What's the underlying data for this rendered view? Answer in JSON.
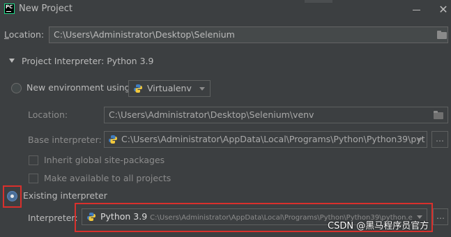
{
  "window": {
    "title": "New Project"
  },
  "location": {
    "label": "Location:",
    "value": "C:\\Users\\Administrator\\Desktop\\Selenium"
  },
  "interpreter_section": {
    "header": "Project Interpreter: Python 3.9"
  },
  "new_env": {
    "radio_label": "New environment using",
    "tool": "Virtualenv",
    "location_label": "Location:",
    "location_value": "C:\\Users\\Administrator\\Desktop\\Selenium\\venv",
    "base_label": "Base interpreter:",
    "base_value": "C:\\Users\\Administrator\\AppData\\Local\\Programs\\Python\\Python39\\pyt",
    "browse_label": "...",
    "inherit_label": "Inherit global site-packages",
    "make_available_label": "Make available to all projects"
  },
  "existing": {
    "radio_label": "Existing interpreter",
    "interpreter_label": "Interpreter:",
    "interpreter_name": "Python 3.9",
    "interpreter_path": "C:\\Users\\Administrator\\AppData\\Local\\Programs\\Python\\Python39\\python.e",
    "browse_label": "..."
  },
  "watermark": "CSDN @黑马程序员官方",
  "colors": {
    "background": "#3c3f41",
    "highlight_box": "#d9302c",
    "selected_radio": "#4a6f99"
  }
}
